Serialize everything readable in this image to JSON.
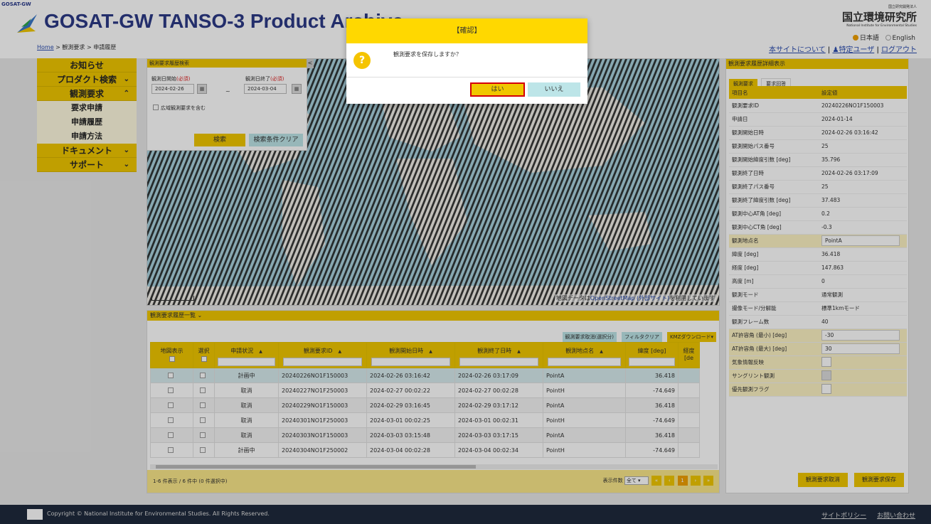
{
  "header": {
    "corner_logo": "GOSAT-GW",
    "title": "GOSAT-GW TANSO-3 Product Archive",
    "breadcrumb": [
      "Home",
      "観測要求",
      "申請履歴"
    ],
    "breadcrumb_sep": ">",
    "org_small": "国立研究開発法人",
    "org_name": "国立環境研究所",
    "org_en": "National Institute for Environmental Studies",
    "lang_ja": "日本語",
    "lang_en": "English",
    "link_about": "本サイトについて",
    "link_user": "特定ユーザ",
    "link_logout": "ログアウト",
    "link_sep": "|"
  },
  "sidebar": {
    "items": [
      {
        "label": "お知らせ",
        "type": "main",
        "chevron": ""
      },
      {
        "label": "プロダクト検索",
        "type": "main",
        "chevron": "⌄"
      },
      {
        "label": "観測要求",
        "type": "main",
        "chevron": "⌃"
      },
      {
        "label": "要求申請",
        "type": "sub"
      },
      {
        "label": "申請履歴",
        "type": "sub"
      },
      {
        "label": "申請方法",
        "type": "sub"
      },
      {
        "label": "ドキュメント",
        "type": "main",
        "chevron": "⌄"
      },
      {
        "label": "サポート",
        "type": "main",
        "chevron": "⌄"
      }
    ]
  },
  "search": {
    "title": "観測要求履歴検索",
    "start_label": "観測日開始",
    "end_label": "観測日終了",
    "required": "(必須)",
    "start_value": "2024-02-26",
    "end_value": "2024-03-04",
    "tilde": "~",
    "wide_label": "広域観測要求を含む",
    "search_button": "検索",
    "clear_button": "検索条件クリア",
    "collapse": "<"
  },
  "map": {
    "attribution_prefix": "地図データは",
    "attribution_link": "OpenStreetMap (外部サイト)",
    "attribution_suffix": "を利用しています"
  },
  "results": {
    "title": "観測要求履歴一覧",
    "title_chevron": "⌄",
    "tools": [
      "観測要求取消(選択分)",
      "フィルタクリア",
      "KMZダウンロード▾"
    ],
    "columns": [
      "地図表示",
      "選択",
      "申請状況",
      "観測要求ID",
      "観測開始日時",
      "観測終了日時",
      "観測地点名",
      "緯度 [deg]",
      "経度 [de"
    ],
    "rows": [
      {
        "status": "計画中",
        "id": "20240226NO1F150003",
        "start": "2024-02-26 03:16:42",
        "end": "2024-02-26 03:17:09",
        "site": "PointA",
        "lat": "36.418"
      },
      {
        "status": "取消",
        "id": "20240227NO1F250003",
        "start": "2024-02-27 00:02:22",
        "end": "2024-02-27 00:02:28",
        "site": "PointH",
        "lat": "-74.649"
      },
      {
        "status": "取消",
        "id": "20240229NO1F150003",
        "start": "2024-02-29 03:16:45",
        "end": "2024-02-29 03:17:12",
        "site": "PointA",
        "lat": "36.418"
      },
      {
        "status": "取消",
        "id": "20240301NO1F250003",
        "start": "2024-03-01 00:02:25",
        "end": "2024-03-01 00:02:31",
        "site": "PointH",
        "lat": "-74.649"
      },
      {
        "status": "取消",
        "id": "20240303NO1F150003",
        "start": "2024-03-03 03:15:48",
        "end": "2024-03-03 03:17:15",
        "site": "PointA",
        "lat": "36.418"
      },
      {
        "status": "計画中",
        "id": "20240304NO1F250002",
        "start": "2024-03-04 00:02:28",
        "end": "2024-03-04 00:02:34",
        "site": "PointH",
        "lat": "-74.649"
      }
    ],
    "count_text": "1-6 件表示 / 6 件中 (0 件選択中)",
    "page_size_label": "表示件数",
    "page_size_value": "全て",
    "pages": [
      "«",
      "‹",
      "1",
      "›",
      "»"
    ]
  },
  "detail": {
    "title": "観測要求履歴詳細表示",
    "tabs": [
      "観測要求",
      "要求回答"
    ],
    "col_item": "項目名",
    "col_value": "設定値",
    "rows": [
      {
        "label": "観測要求ID",
        "value": "20240226NO1F150003",
        "kind": "text"
      },
      {
        "label": "申請日",
        "value": "2024-01-14",
        "kind": "text"
      },
      {
        "label": "観測開始日時",
        "value": "2024-02-26 03:16:42",
        "kind": "text"
      },
      {
        "label": "観測開始パス番号",
        "value": "25",
        "kind": "text"
      },
      {
        "label": "観測開始緯度引数 [deg]",
        "value": "35.796",
        "kind": "text"
      },
      {
        "label": "観測終了日時",
        "value": "2024-02-26 03:17:09",
        "kind": "text"
      },
      {
        "label": "観測終了パス番号",
        "value": "25",
        "kind": "text"
      },
      {
        "label": "観測終了緯度引数 [deg]",
        "value": "37.483",
        "kind": "text"
      },
      {
        "label": "観測中心AT角 [deg]",
        "value": "0.2",
        "kind": "text"
      },
      {
        "label": "観測中心CT角 [deg]",
        "value": "-0.3",
        "kind": "text"
      },
      {
        "label": "観測地点名",
        "value": "PointA",
        "kind": "input"
      },
      {
        "label": "緯度 [deg]",
        "value": "36.418",
        "kind": "text"
      },
      {
        "label": "経度 [deg]",
        "value": "147.863",
        "kind": "text"
      },
      {
        "label": "高度 [m]",
        "value": "0",
        "kind": "text"
      },
      {
        "label": "観測モード",
        "value": "通常観測",
        "kind": "text"
      },
      {
        "label": "撮像モード/分解能",
        "value": "標準1kmモード",
        "kind": "text"
      },
      {
        "label": "観測フレーム数",
        "value": "40",
        "kind": "text"
      },
      {
        "label": "AT許容角 (最小) [deg]",
        "value": "-30",
        "kind": "input"
      },
      {
        "label": "AT許容角 (最大) [deg]",
        "value": "30",
        "kind": "input"
      },
      {
        "label": "気象情報反映",
        "value": "",
        "kind": "check"
      },
      {
        "label": "サングリント観測",
        "value": "",
        "kind": "check-disabled"
      },
      {
        "label": "優先観測フラグ",
        "value": "",
        "kind": "check"
      }
    ],
    "cancel_button": "観測要求取消",
    "save_button": "観測要求保存"
  },
  "dialog": {
    "title": "【確認】",
    "message": "観測要求を保存しますか？",
    "icon": "?",
    "yes": "はい",
    "no": "いいえ"
  },
  "footer": {
    "copyright": "Copyright © National Institute for Environmental Studies. All Rights Reserved.",
    "policy": "サイトポリシー",
    "contact": "お問い合わせ"
  },
  "colors": {
    "accent": "#f0c700",
    "dialog_title": "#ffd800",
    "secondary_button": "#bde5e8",
    "highlight_border": "#d40000",
    "footer": "#1f2a3c",
    "title_text": "#2c3a86"
  }
}
